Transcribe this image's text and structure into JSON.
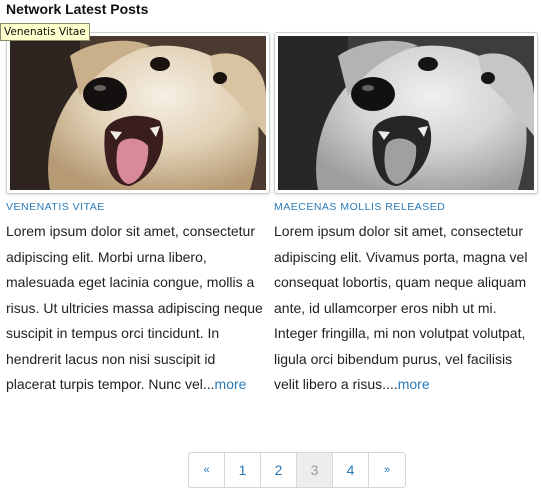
{
  "widget": {
    "title": "Network Latest Posts"
  },
  "tooltip": {
    "text": "Venenatis Vitae"
  },
  "posts": [
    {
      "title": "VENENATIS VITAE",
      "excerpt": "Lorem ipsum dolor sit amet, consectetur adipiscing elit. Morbi urna libero, malesuada eget lacinia congue, mollis a risus. Ut ultricies massa adipiscing neque suscipit in tempus orci tincidunt. In hendrerit lacus non nisi suscipit id placerat turpis tempor. Nunc vel...",
      "more": "more",
      "image": "dog-photo-color"
    },
    {
      "title": "MAECENAS MOLLIS RELEASED",
      "excerpt": "Lorem ipsum dolor sit amet, consectetur adipiscing elit. Vivamus porta, magna vel consequat lobortis, quam neque aliquam ante, id ullamcorper eros nibh ut mi. Integer fringilla, mi non volutpat volutpat, ligula orci bibendum purus, vel facilisis velit libero a risus....",
      "more": "more",
      "image": "dog-photo-grayscale"
    }
  ],
  "pagination": {
    "prev": "«",
    "pages": [
      "1",
      "2",
      "3",
      "4"
    ],
    "current": "3",
    "next": "»"
  },
  "colors": {
    "link": "#2a7ab8",
    "tooltip_bg": "#ffffcc",
    "current_page_bg": "#ededed"
  }
}
